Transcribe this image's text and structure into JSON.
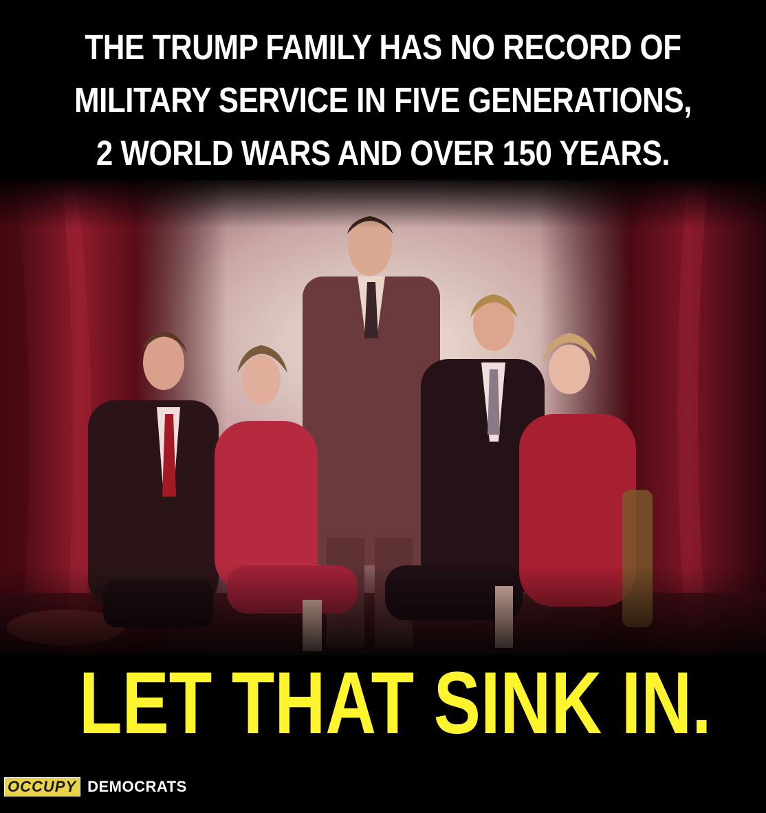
{
  "headline": {
    "line1": "THE TRUMP FAMILY HAS NO RECORD OF",
    "line2": "MILITARY SERVICE IN FIVE GENERATIONS,",
    "line3": "2 WORLD WARS AND OVER 150 YEARS."
  },
  "tagline": "LET THAT SINK IN.",
  "brand": {
    "boxed": "OCCUPY",
    "word": "DEMOCRATS"
  },
  "colors": {
    "headline": "#ffffff",
    "tagline": "#fff52e",
    "logo_box": "#e9d34a",
    "background": "#000000",
    "curtain": "#7a1420"
  }
}
